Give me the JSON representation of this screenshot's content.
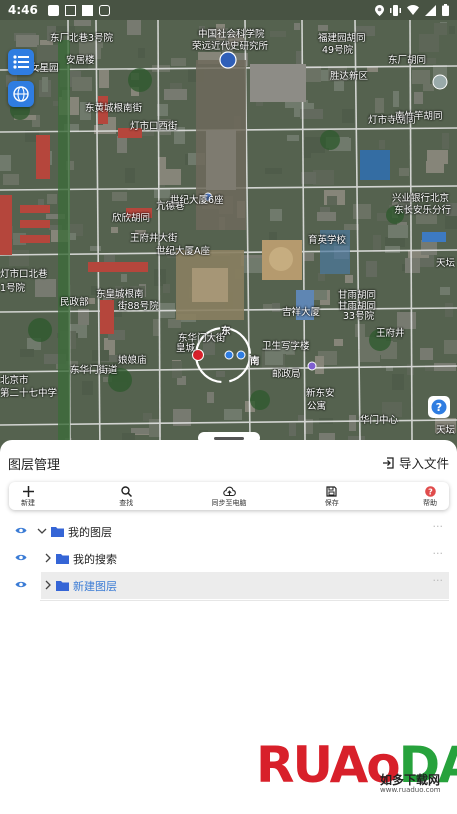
{
  "status": {
    "time": "4:46"
  },
  "map": {
    "labels": [
      "东厂北巷3号院",
      "中国社会科学院",
      "荣远近代史研究所",
      "福建园胡同",
      "49号院",
      "女星园",
      "安居楼",
      "东厂胡同",
      "东黄城根南街",
      "灯市口西街",
      "灯市寺胡同",
      "胜达新区",
      "南竹竿胡同",
      "亢德巷",
      "王府井大街",
      "世纪大厦6座",
      "欣欣胡同",
      "兴业银行北京",
      "东长安乐分行",
      "世纪大厦A座",
      "育英学校",
      "灯市口北巷",
      "1号院",
      "甘雨胡同",
      "甘雨胡同",
      "33号院",
      "天坛",
      "天坛",
      "东皇城根南",
      "街88号院",
      "民政部",
      "吉祥大厦",
      "卫生写字楼",
      "东华门街道",
      "娘娘庙",
      "东华门大街",
      "北京市",
      "第二十七中学",
      "皇城",
      "新东安",
      "公寓",
      "华门中心",
      "王府井",
      "邮政局"
    ]
  },
  "compass": {
    "east": "东",
    "south": "南"
  },
  "sheet": {
    "title": "图层管理",
    "import_label": "导入文件",
    "tools": [
      {
        "icon": "plus-icon",
        "label": "新建"
      },
      {
        "icon": "search-icon",
        "label": "查找"
      },
      {
        "icon": "cloud-sync-icon",
        "label": "同步至电脑"
      },
      {
        "icon": "save-icon",
        "label": "保存"
      },
      {
        "icon": "help-icon",
        "label": "帮助"
      }
    ],
    "layers": [
      {
        "name": "我的图层",
        "expanded": true,
        "selected": false,
        "indent": 0
      },
      {
        "name": "我的搜索",
        "expanded": false,
        "selected": false,
        "indent": 1
      },
      {
        "name": "新建图层",
        "expanded": false,
        "selected": true,
        "indent": 1
      }
    ],
    "more_label": "···"
  },
  "watermark": {
    "logo_a": "RUA",
    "logo_b": "DAO",
    "logo_c": "o",
    "sub": "如多下载网",
    "url": "www.ruaduo.com"
  },
  "colors": {
    "accent": "#3a7bd5",
    "folder": "#3565d6",
    "help": "#e04c4c",
    "logo_red": "#d8202a",
    "logo_green": "#27a23c"
  }
}
